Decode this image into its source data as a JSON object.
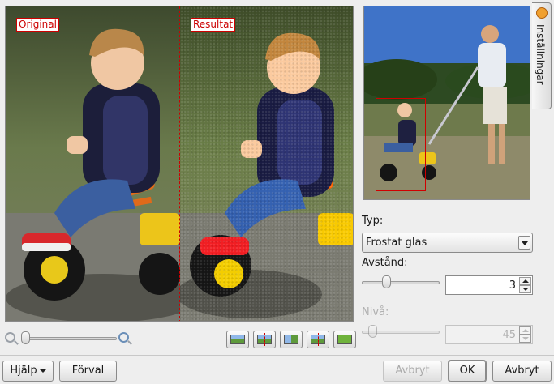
{
  "preview": {
    "label_original": "Original",
    "label_result": "Resultat"
  },
  "settings_tab": {
    "label": "Inställningar",
    "icon": "wrench-icon"
  },
  "type": {
    "label": "Typ:",
    "selected": "Frostat glas"
  },
  "distance": {
    "label": "Avstånd:",
    "value": "3",
    "slider_level": 0.03
  },
  "level": {
    "label": "Nivå:",
    "value": "45",
    "slider_level": 0.05,
    "disabled": true
  },
  "zoom": {
    "slider_level": 0.0
  },
  "buttons": {
    "help": "Hjälp",
    "defaults": "Förval",
    "cancel_disabled": "Avbryt",
    "ok": "OK",
    "cancel": "Avbryt"
  },
  "colors": {
    "accent_red": "#cc0000",
    "selection": "#d00000"
  }
}
